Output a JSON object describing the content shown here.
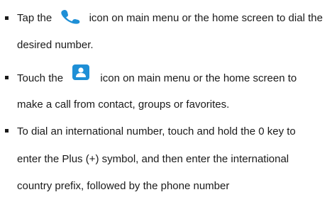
{
  "list": {
    "items": [
      {
        "line1_before": "Tap the",
        "icon": "phone-icon",
        "line1_after": "icon on main menu or the home screen to dial the",
        "line2": "desired number."
      },
      {
        "line1_before": "Touch the",
        "icon": "contacts-icon",
        "line1_after": "icon on main menu or the home screen to",
        "line2": "make a call from contact, groups or favorites."
      },
      {
        "line1": "To dial an international number, touch and hold the 0 key to",
        "line2": "enter the Plus (+) symbol, and then enter the international",
        "line3": "country prefix, followed by the phone number"
      }
    ]
  },
  "colors": {
    "text": "#1a1a1a",
    "icon_blue": "#1e8fd6"
  }
}
